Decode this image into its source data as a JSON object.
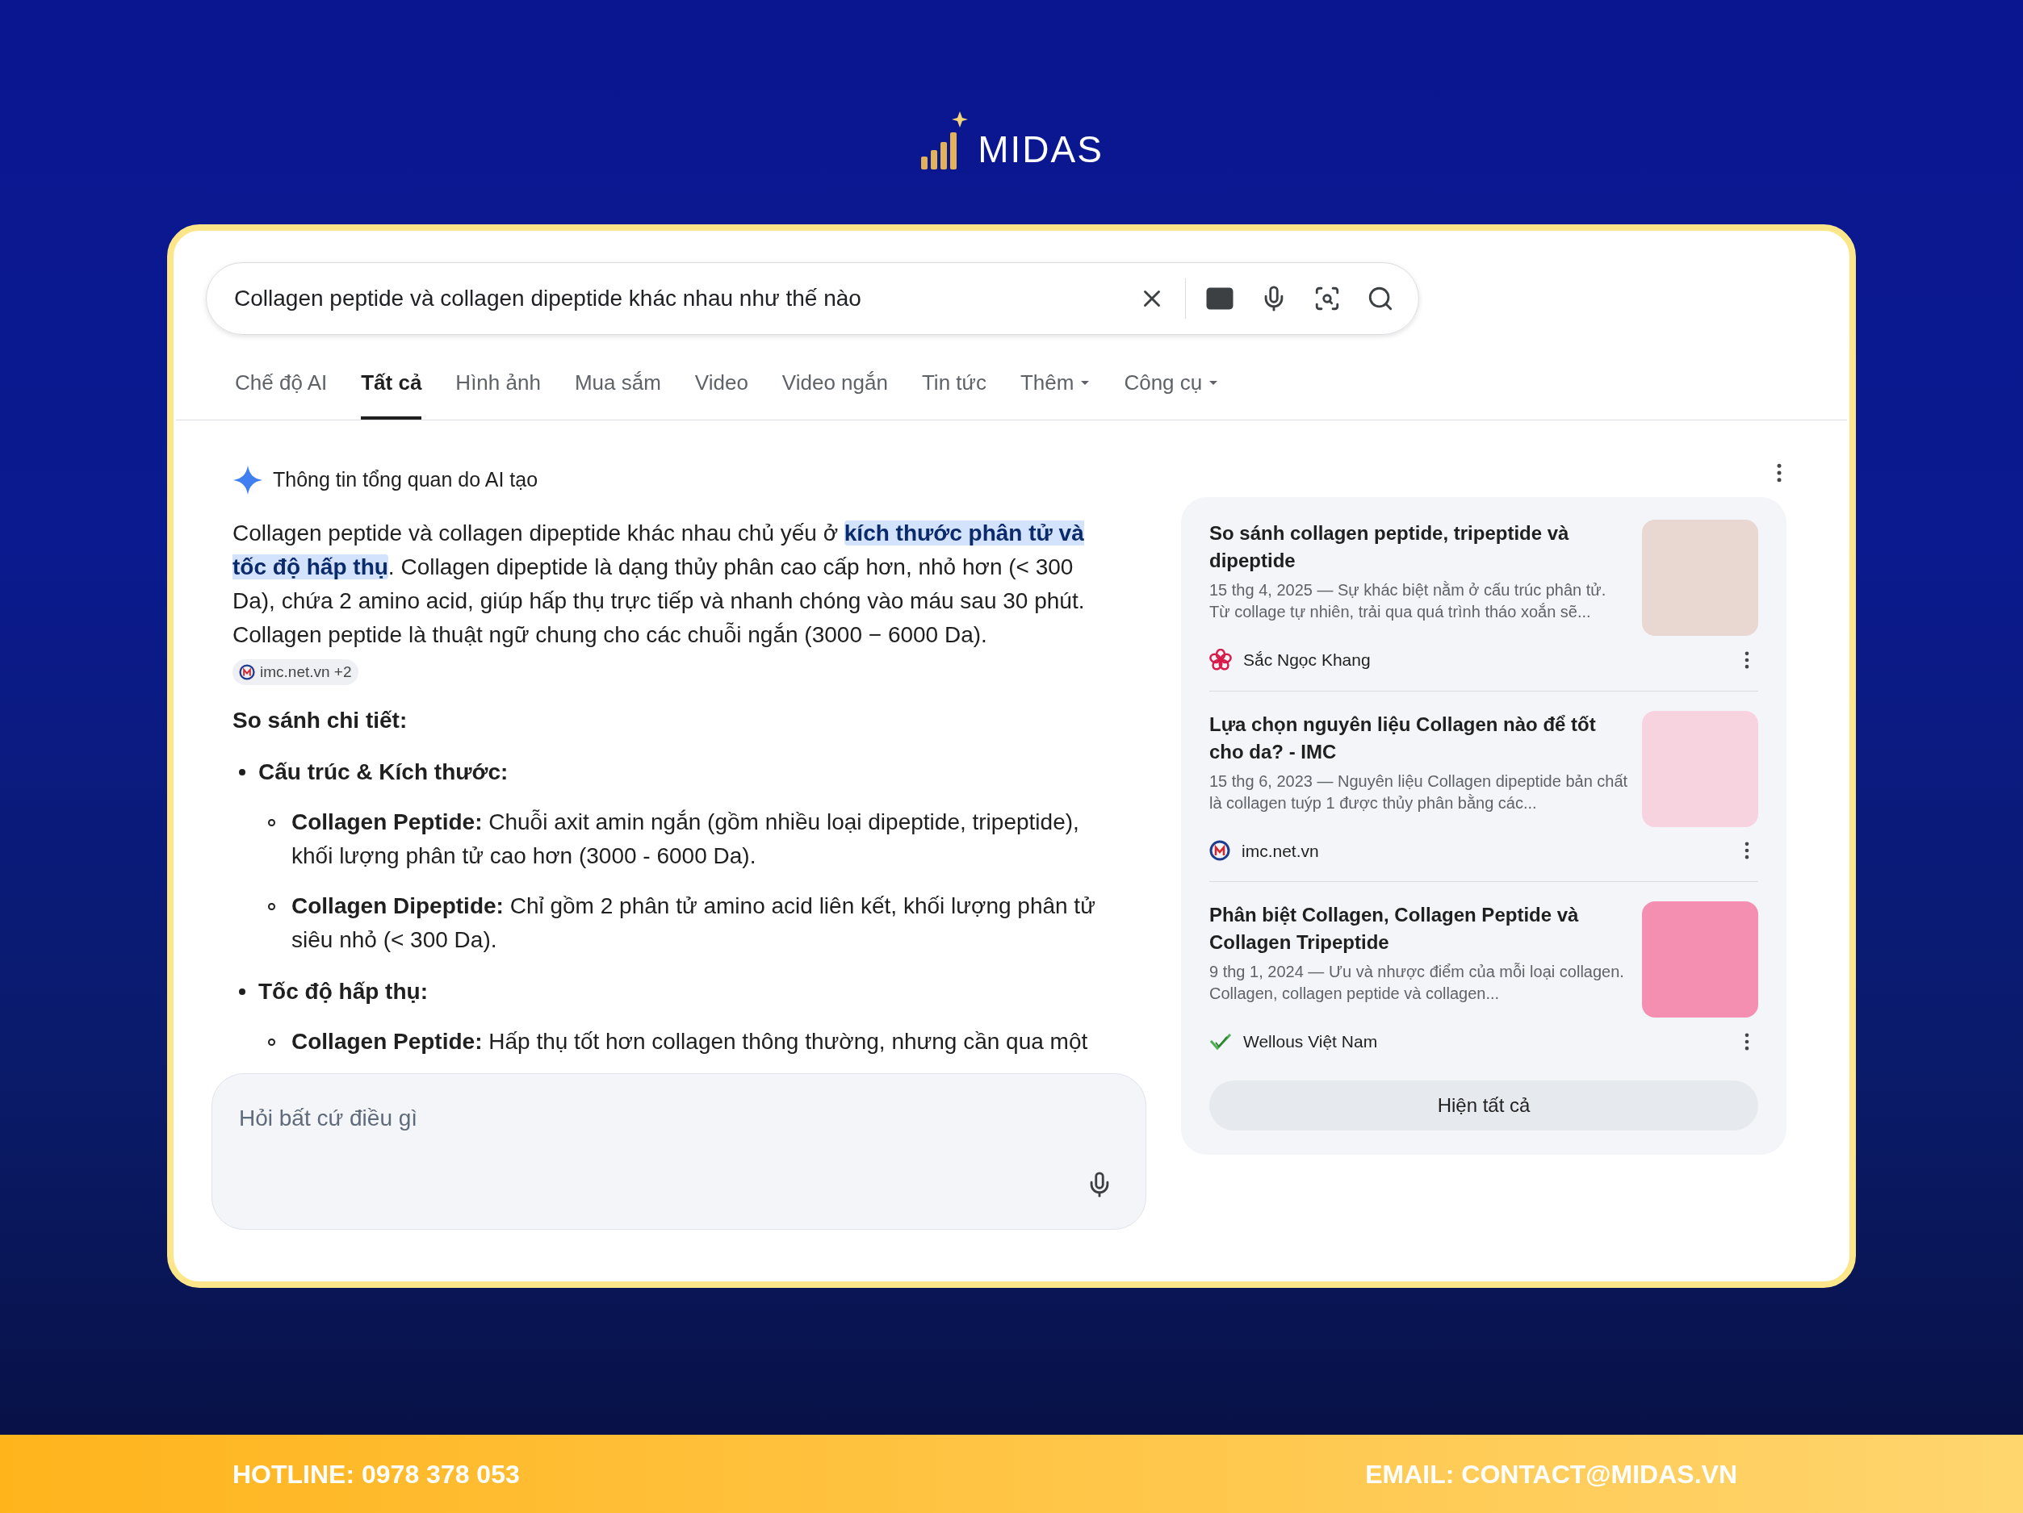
{
  "brand": {
    "name": "MIDAS"
  },
  "search": {
    "value": "Collagen peptide và collagen dipeptide khác nhau như thế nào"
  },
  "tabs": [
    {
      "label": "Chế độ AI",
      "selected": false,
      "dropdown": false
    },
    {
      "label": "Tất cả",
      "selected": true,
      "dropdown": false
    },
    {
      "label": "Hình ảnh",
      "selected": false,
      "dropdown": false
    },
    {
      "label": "Mua sắm",
      "selected": false,
      "dropdown": false
    },
    {
      "label": "Video",
      "selected": false,
      "dropdown": false
    },
    {
      "label": "Video ngắn",
      "selected": false,
      "dropdown": false
    },
    {
      "label": "Tin tức",
      "selected": false,
      "dropdown": false
    },
    {
      "label": "Thêm",
      "selected": false,
      "dropdown": true
    },
    {
      "label": "Công cụ",
      "selected": false,
      "dropdown": true
    }
  ],
  "ai_overview": {
    "title": "Thông tin tổng quan do AI tạo",
    "summary": "Collagen peptide và collagen dipeptide khác nhau chủ yếu ở **kích thước phân tử và tốc độ hấp thụ**. Collagen dipeptide là dạng thủy phân cao cấp hơn, nhỏ hơn (< 300 Da), chứa 2 amino acid, giúp hấp thụ trực tiếp và nhanh chóng vào máu sau 30 phút. Collagen peptide là thuật ngữ chung cho các chuỗi ngắn (3000 − 6000 Da).",
    "source_chip": "imc.net.vn +2",
    "heading": "So sánh chi tiết:",
    "sections": [
      {
        "title": "Cấu trúc & Kích thước:",
        "children": [
          {
            "text": "**Collagen Peptide:** Chuỗi axit amin ngắn (gồm nhiều loại dipeptide, tripeptide), khối lượng phân tử cao hơn (3000 - 6000 Da)."
          },
          {
            "text": "**Collagen Dipeptide:** Chỉ gồm 2 phân tử amino acid liên kết, khối lượng phân tử siêu nhỏ (< 300 Da)."
          }
        ]
      },
      {
        "title": "Tốc độ hấp thụ:",
        "children": [
          {
            "text": "**Collagen Peptide:** Hấp thụ tốt hơn collagen thông thường, nhưng cần qua một"
          }
        ]
      }
    ]
  },
  "sources": {
    "cards": [
      {
        "title": "So sánh collagen peptide, tripeptide và dipeptide",
        "snippet": "15 thg 4, 2025 — Sự khác biệt nằm ở cấu trúc phân tử. Từ collage tự nhiên, trải qua quá trình tháo xoắn sẽ...",
        "site": "Sắc Ngọc Khang"
      },
      {
        "title": "Lựa chọn nguyên liệu Collagen nào để tốt cho da? - IMC",
        "snippet": "15 thg 6, 2023 — Nguyên liệu Collagen dipeptide bản chất là collagen tuýp 1 được thủy phân bằng các...",
        "site": "imc.net.vn"
      },
      {
        "title": "Phân biệt Collagen, Collagen Peptide và Collagen Tripeptide",
        "snippet": "9 thg 1, 2024 — Ưu và nhược điểm của mỗi loại collagen. Collagen, collagen peptide và collagen...",
        "site": "Wellous Việt Nam"
      }
    ],
    "button": "Hiện tất cả"
  },
  "ask": {
    "placeholder": "Hỏi bất cứ điều gì"
  },
  "footer": {
    "hotline": "HOTLINE: 0978 378 053",
    "email": "EMAIL: CONTACT@MIDAS.VN"
  }
}
